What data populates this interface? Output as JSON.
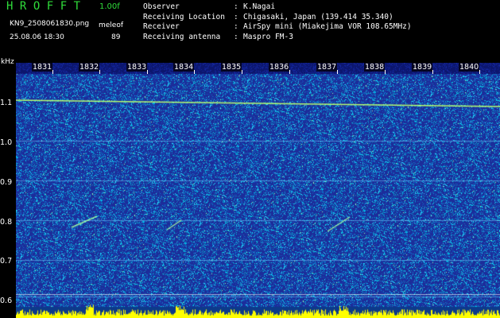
{
  "header": {
    "app_title": "HROFFT",
    "version": "1.00f",
    "filename": "KN9_2508061830.png",
    "datetime": "25.08.06 18:30",
    "unit_label": "meleof",
    "count": "89"
  },
  "info": [
    {
      "key": "Observer",
      "value": "K.Nagai"
    },
    {
      "key": "Receiving Location",
      "value": "Chigasaki, Japan (139.414 35.340)"
    },
    {
      "key": "Receiver",
      "value": "AirSpy mini (Miakejima VOR 108.65MHz)"
    },
    {
      "key": "Receiving antenna",
      "value": "Maspro FM-3"
    }
  ],
  "axis": {
    "freq_unit": "kHz",
    "freq_labels": [
      "1.1",
      "1.0",
      "0.9",
      "0.8",
      "0.7",
      "0.6"
    ],
    "time_labels": [
      "1831",
      "1832",
      "1833",
      "1834",
      "1835",
      "1836",
      "1837",
      "1838",
      "1839",
      "1840"
    ]
  },
  "colors": {
    "background": "#1c2d9a",
    "carrier": "#b8ff70",
    "noise": "#00e8ff",
    "bottom_strip": "#ffff00",
    "title_green": "#2fdc3a"
  }
}
